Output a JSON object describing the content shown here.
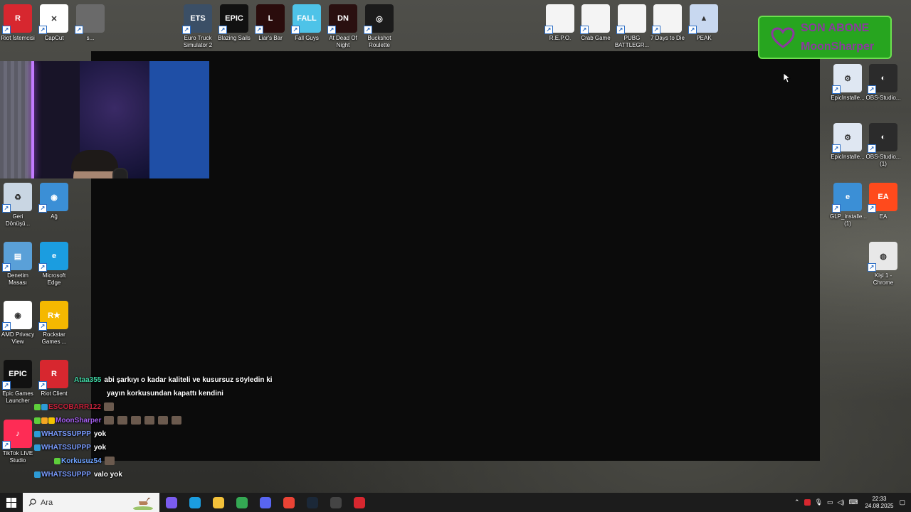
{
  "desktop": {
    "top_row": [
      {
        "label": "Riot İstemcisi",
        "color": "#d7272f",
        "glyph": "R"
      },
      {
        "label": "CapCut",
        "color": "#ffffff",
        "glyph": "✕"
      },
      {
        "label": "s...",
        "color": "#6a6a6a",
        "glyph": ""
      },
      {
        "label": "Euro Truck Simulator 2",
        "color": "#3b4f66",
        "glyph": "ETS"
      },
      {
        "label": "Blazing Sails",
        "color": "#111111",
        "glyph": "EPIC"
      },
      {
        "label": "Liar's Bar",
        "color": "#2a0c0c",
        "glyph": "L"
      },
      {
        "label": "Fall Guys",
        "color": "#4ec3e8",
        "glyph": "FALL"
      },
      {
        "label": "At Dead Of Night",
        "color": "#2a1010",
        "glyph": "DN"
      },
      {
        "label": "Buckshot Roulette",
        "color": "#1b1b1b",
        "glyph": "◎"
      },
      {
        "label": "R.E.P.O.",
        "color": "#f4f4f4",
        "glyph": ""
      },
      {
        "label": "Crab Game",
        "color": "#f4f4f4",
        "glyph": ""
      },
      {
        "label": "PUBG BATTLEGR...",
        "color": "#f4f4f4",
        "glyph": ""
      },
      {
        "label": "7 Days to Die",
        "color": "#f4f4f4",
        "glyph": ""
      },
      {
        "label": "PEAK",
        "color": "#c8d8f0",
        "glyph": "▲"
      }
    ],
    "left_col": [
      {
        "label": "Geri Dönüşü...",
        "color": "#c9d6e3",
        "glyph": "♻"
      },
      {
        "label": "Ağ",
        "color": "#3b8fd6",
        "glyph": "◉"
      },
      {
        "label": "Denetim Masası",
        "color": "#5aa0d8",
        "glyph": "▤"
      },
      {
        "label": "Microsoft Edge",
        "color": "#1b9de0",
        "glyph": "e"
      },
      {
        "label": "AMD Privacy View",
        "color": "#ffffff",
        "glyph": "◉"
      },
      {
        "label": "Rockstar Games ...",
        "color": "#f5b800",
        "glyph": "R★"
      },
      {
        "label": "Epic Games Launcher",
        "color": "#111111",
        "glyph": "EPIC"
      },
      {
        "label": "Riot Client",
        "color": "#d7272f",
        "glyph": "R"
      },
      {
        "label": "TikTok LIVE Studio",
        "color": "#fe2c55",
        "glyph": "♪"
      }
    ],
    "right_col": [
      {
        "label": "EpicInstalle...",
        "color": "#dfe7f2",
        "glyph": "⚙"
      },
      {
        "label": "OBS-Studio...",
        "color": "#2b2b2b",
        "glyph": "◐"
      },
      {
        "label": "EpicInstalle...",
        "color": "#dfe7f2",
        "glyph": "⚙"
      },
      {
        "label": "OBS-Studio... (1)",
        "color": "#2b2b2b",
        "glyph": "◐"
      },
      {
        "label": "GLP_installe... (1)",
        "color": "#3b8fd6",
        "glyph": "e"
      },
      {
        "label": "EA",
        "color": "#ff4a1c",
        "glyph": "EA"
      },
      {
        "label": "Kişi 1 - Chrome",
        "color": "#e8e8e8",
        "glyph": "◍"
      }
    ]
  },
  "overlay": {
    "sub_title": "SON ABONE",
    "sub_name": "MoonSharper"
  },
  "chat": [
    {
      "user": "Ataa355",
      "user_color": "#3fd6a4",
      "badges": [],
      "text": "abi şarkıyı o kadar kaliteli ve kusursuz söyledin ki",
      "emotes": 0
    },
    {
      "user": "",
      "user_color": "#ffffff",
      "badges": [],
      "text": "yayın korkusundan kapattı kendini",
      "emotes": 0,
      "indent": true
    },
    {
      "user": "ESCOBARR122",
      "user_color": "#c4213a",
      "badges": [
        "#5ecf3b",
        "#2d9bd6"
      ],
      "text": "",
      "emotes": 1
    },
    {
      "user": "MoonSharper",
      "user_color": "#a45ef0",
      "badges": [
        "#5ecf3b",
        "#f5a623",
        "#f5c400"
      ],
      "text": "",
      "emotes": 6
    },
    {
      "user": "WHATSSUPPP",
      "user_color": "#7a9cff",
      "badges": [
        "#2d9bd6"
      ],
      "text": "yok",
      "emotes": 0
    },
    {
      "user": "WHATSSUPPP",
      "user_color": "#7a9cff",
      "badges": [
        "#2d9bd6"
      ],
      "text": "yok",
      "emotes": 0
    },
    {
      "user": "Korkusuz54",
      "user_color": "#6ea3ff",
      "badges": [
        "#5ecf3b"
      ],
      "text": "",
      "emotes": 1
    },
    {
      "user": "WHATSSUPPP",
      "user_color": "#7a9cff",
      "badges": [
        "#2d9bd6"
      ],
      "text": "valo yok",
      "emotes": 0
    }
  ],
  "taskbar": {
    "search_placeholder": "Ara",
    "apps": [
      {
        "name": "copilot",
        "color": "#7b5cf0"
      },
      {
        "name": "edge",
        "color": "#1b9de0"
      },
      {
        "name": "file-explorer",
        "color": "#f3c13a"
      },
      {
        "name": "chrome",
        "color": "#34a853"
      },
      {
        "name": "discord",
        "color": "#5865f2"
      },
      {
        "name": "chrome-profile",
        "color": "#ea4335"
      },
      {
        "name": "steam",
        "color": "#1b2838"
      },
      {
        "name": "obs",
        "color": "#444444"
      },
      {
        "name": "riot-client",
        "color": "#d7272f"
      }
    ],
    "time": "22:33",
    "date": "24.08.2025"
  }
}
